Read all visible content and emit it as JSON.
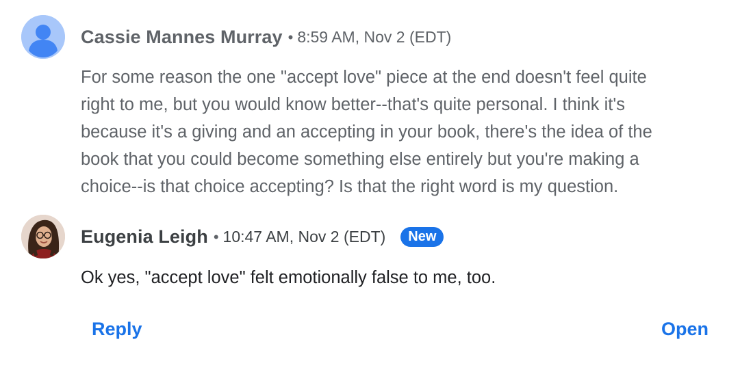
{
  "comments": [
    {
      "author": "Cassie Mannes Murray",
      "separator": "•",
      "timestamp": "8:59 AM, Nov 2 (EDT)",
      "avatar": "default-person-icon",
      "body_lines": [
        "For some reason the one \"accept love\" piece at the end doesn't feel quite",
        "right to me, but you would know better--that's quite personal. I think it's",
        "because it's a giving and an accepting in your book, there's the idea of the",
        "book that you could become something else entirely but you're making a",
        "choice--is that choice accepting? Is that the right word is my question."
      ]
    },
    {
      "author": "Eugenia Leigh",
      "separator": "•",
      "timestamp": "10:47 AM, Nov 2 (EDT)",
      "badge": "New",
      "avatar": "profile-photo",
      "body_lines": [
        "Ok yes, \"accept love\" felt emotionally false to me, too."
      ]
    }
  ],
  "actions": {
    "reply": "Reply",
    "open": "Open"
  },
  "colors": {
    "accent": "#1a73e8",
    "muted_text": "#5f6368",
    "dark_text": "#202124",
    "default_avatar_bg": "#a8c7fa",
    "default_avatar_fg": "#4285f4"
  }
}
